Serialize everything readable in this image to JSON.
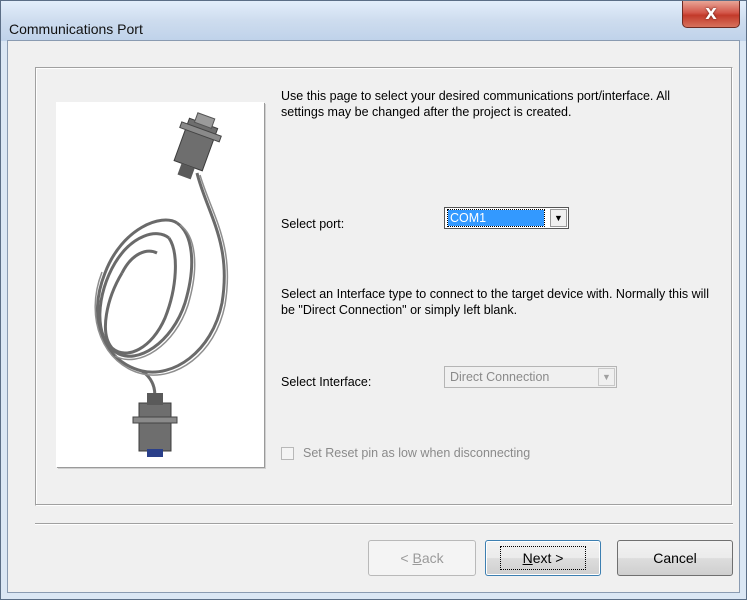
{
  "window": {
    "title": "Communications Port",
    "close_glyph": "X"
  },
  "page": {
    "description": "Use this page to select your desired communications port/interface. All settings may be changed after the project is created.",
    "port_label": "Select port:",
    "port_value": "COM1",
    "interface_description": "Select an Interface type to connect to the target device with. Normally this will be \"Direct Connection\" or simply left blank.",
    "interface_label": "Select Interface:",
    "interface_value": "Direct Connection",
    "reset_checkbox_label": "Set Reset pin as low when disconnecting",
    "reset_checkbox_checked": false
  },
  "image": {
    "icon": "serial-cable-icon"
  },
  "buttons": {
    "back_prefix": "< ",
    "back_mnemonic": "B",
    "back_rest": "ack",
    "next_mnemonic": "N",
    "next_rest": "ext >",
    "cancel": "Cancel"
  },
  "colors": {
    "selection": "#3399ff",
    "close_red": "#c23a2a"
  }
}
